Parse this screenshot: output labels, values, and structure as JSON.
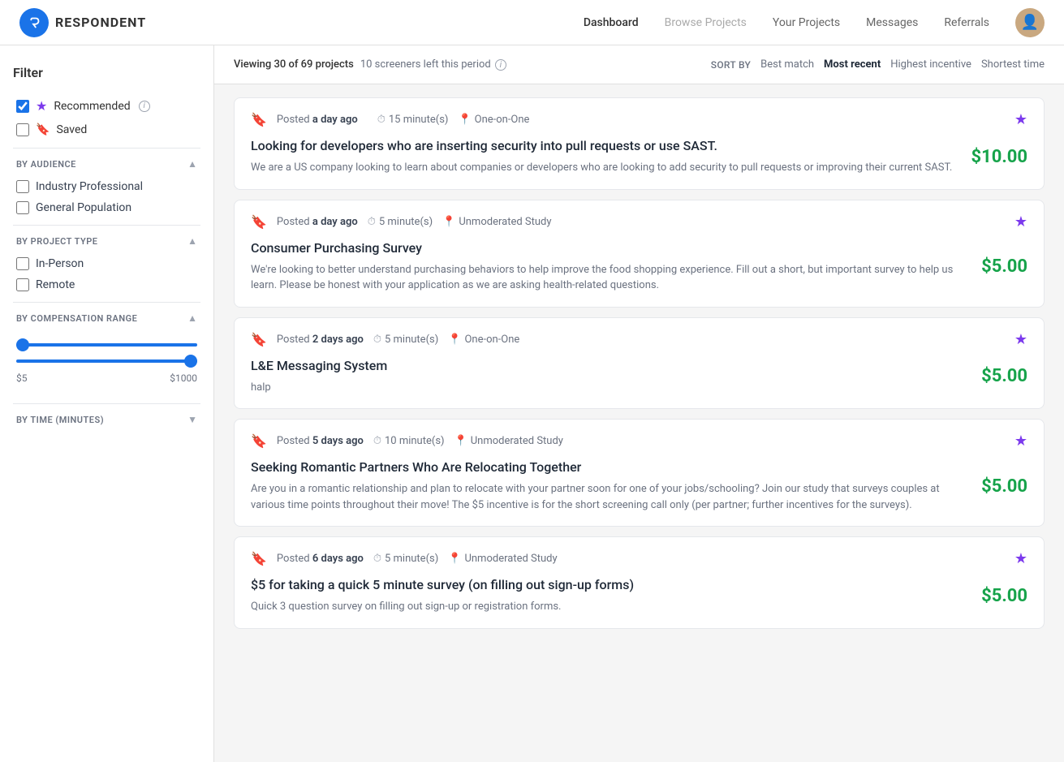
{
  "nav": {
    "logo_text": "RESPONDENT",
    "logo_icon": "R",
    "links": [
      {
        "id": "dashboard",
        "label": "Dashboard",
        "state": "active"
      },
      {
        "id": "browse-projects",
        "label": "Browse Projects",
        "state": "dimmed"
      },
      {
        "id": "your-projects",
        "label": "Your Projects",
        "state": "normal"
      },
      {
        "id": "messages",
        "label": "Messages",
        "state": "normal"
      },
      {
        "id": "referrals",
        "label": "Referrals",
        "state": "normal"
      }
    ]
  },
  "sidebar": {
    "title": "Filter",
    "recommended": {
      "label": "Recommended",
      "checked": true
    },
    "saved": {
      "label": "Saved",
      "checked": false
    },
    "by_audience": {
      "label": "BY AUDIENCE",
      "options": [
        {
          "id": "industry-professional",
          "label": "Industry Professional",
          "checked": false
        },
        {
          "id": "general-population",
          "label": "General Population",
          "checked": false
        }
      ]
    },
    "by_project_type": {
      "label": "BY PROJECT TYPE",
      "options": [
        {
          "id": "in-person",
          "label": "In-Person",
          "checked": false
        },
        {
          "id": "remote",
          "label": "Remote",
          "checked": false
        }
      ]
    },
    "by_compensation": {
      "label": "BY COMPENSATION RANGE",
      "min_label": "$5",
      "max_label": "$1000",
      "min_value": 5,
      "max_value": 1000
    },
    "by_time": {
      "label": "BY TIME (MINUTES)"
    }
  },
  "results": {
    "viewing_count": "Viewing 30 of 69 projects",
    "screeners_left": "10 screeners left this period",
    "sort_label": "SORT BY",
    "sort_options": [
      {
        "id": "best-match",
        "label": "Best match",
        "active": false
      },
      {
        "id": "most-recent",
        "label": "Most recent",
        "active": true
      },
      {
        "id": "highest-incentive",
        "label": "Highest incentive",
        "active": false
      },
      {
        "id": "shortest-time",
        "label": "Shortest time",
        "active": false
      }
    ]
  },
  "projects": [
    {
      "id": 1,
      "posted_prefix": "Posted",
      "posted_time": "a day ago",
      "duration": "15 minute(s)",
      "location": "One-on-One",
      "title": "Looking for developers who are inserting security into pull requests or use SAST.",
      "description": "We are a US company looking to learn about companies or developers who are looking to add security to pull requests or improving their current SAST.",
      "price": "$10.00",
      "starred": true
    },
    {
      "id": 2,
      "posted_prefix": "Posted",
      "posted_time": "a day ago",
      "duration": "5 minute(s)",
      "location": "Unmoderated Study",
      "title": "Consumer Purchasing Survey",
      "description": "We're looking to better understand purchasing behaviors to help improve the food shopping experience. Fill out a short, but important survey to help us learn. Please be honest with your application as we are asking health-related questions.",
      "price": "$5.00",
      "starred": true
    },
    {
      "id": 3,
      "posted_prefix": "Posted",
      "posted_time": "2 days ago",
      "duration": "5 minute(s)",
      "location": "One-on-One",
      "title": "L&E Messaging System",
      "description": "halp",
      "price": "$5.00",
      "starred": true
    },
    {
      "id": 4,
      "posted_prefix": "Posted",
      "posted_time": "5 days ago",
      "duration": "10 minute(s)",
      "location": "Unmoderated Study",
      "title": "Seeking Romantic Partners Who Are Relocating Together",
      "description": "Are you in a romantic relationship and plan to relocate with your partner soon for one of your jobs/schooling? Join our study that surveys couples at various time points throughout their move! The $5 incentive is for the short screening call only (per partner; further incentives for the surveys).",
      "price": "$5.00",
      "starred": true
    },
    {
      "id": 5,
      "posted_prefix": "Posted",
      "posted_time": "6 days ago",
      "duration": "5 minute(s)",
      "location": "Unmoderated Study",
      "title": "$5 for taking a quick 5 minute survey (on filling out sign-up forms)",
      "description": "Quick 3 question survey on filling out sign-up or registration forms.",
      "price": "$5.00",
      "starred": true
    }
  ]
}
